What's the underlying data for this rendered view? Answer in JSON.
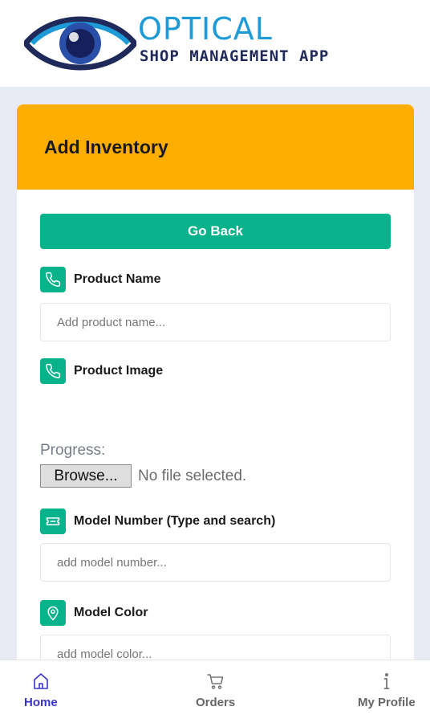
{
  "header": {
    "logo_title": "OPTICAL",
    "logo_subtitle": "SHOP MANAGEMENT APP"
  },
  "card": {
    "title": "Add Inventory",
    "go_back_label": "Go Back"
  },
  "fields": {
    "product_name": {
      "label": "Product Name",
      "placeholder": "Add product name...",
      "icon": "phone-icon"
    },
    "product_image": {
      "label": "Product Image",
      "icon": "phone-icon"
    },
    "model_number": {
      "label": "Model Number (Type and search)",
      "placeholder": "add model number...",
      "icon": "ticket-icon"
    },
    "model_color": {
      "label": "Model Color",
      "placeholder": "add model color...",
      "icon": "map-pin-icon"
    }
  },
  "upload": {
    "progress_label": "Progress:",
    "browse_label": "Browse...",
    "no_file_text": "No file selected."
  },
  "nav": {
    "items": [
      {
        "label": "Home",
        "icon": "home-icon",
        "active": true
      },
      {
        "label": "Orders",
        "icon": "cart-icon",
        "active": false
      },
      {
        "label": "My Profile",
        "icon": "info-icon",
        "active": false
      }
    ]
  },
  "colors": {
    "accent_green": "#08b28b",
    "header_orange": "#feae00",
    "active_nav": "#3a35c9",
    "logo_blue": "#1e9bd7",
    "logo_navy": "#1f2a5a"
  }
}
